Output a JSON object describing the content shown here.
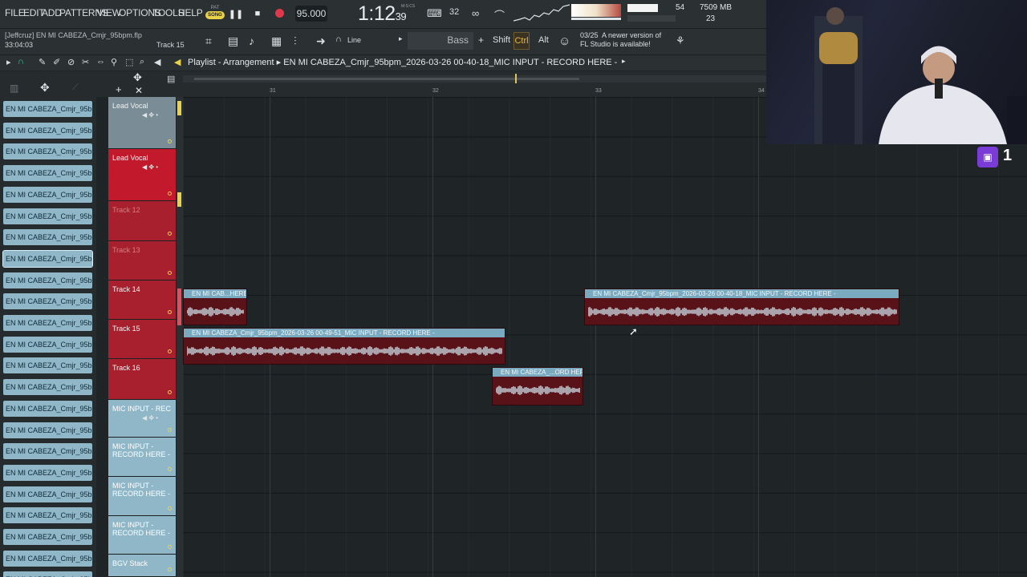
{
  "menu": [
    "FILE",
    "EDIT",
    "ADD",
    "PATTERNS",
    "VIEW",
    "OPTIONS",
    "TOOLS",
    "HELP"
  ],
  "transport": {
    "pat_label": "PAT",
    "song_label": "SONG",
    "tempo": "95.000",
    "clock_main": "1:12",
    "clock_small": "39",
    "clock_unit": "M:S:CS",
    "pattern_number": "32"
  },
  "monitor": {
    "cpu": "54",
    "memory": "7509 MB",
    "polyphony": "23"
  },
  "project": {
    "user": "[Jeffcruz]",
    "file": "EN MI CABEZA_Cmjr_95bpm.flp",
    "time": "33:04:03",
    "hint_track": "Track 15"
  },
  "toolbar": {
    "snap": "Line",
    "preset": "Bass",
    "shift": "Shift",
    "ctrl": "Ctrl",
    "alt": "Alt",
    "notice_date": "03/25",
    "notice_line1": "A newer version of",
    "notice_line2": "FL Studio is available!"
  },
  "playlist": {
    "title": "Playlist - Arrangement",
    "pattern": "EN MI CABEZA_Cmjr_95bpm_2026-03-26 00-40-18_MIC INPUT - RECORD HERE -"
  },
  "ruler": [
    "31",
    "32",
    "33",
    "34"
  ],
  "browser": {
    "items": [
      "EN MI CABEZA_Cmjr_95bp...",
      "EN MI CABEZA_Cmjr_95bp...",
      "EN MI CABEZA_Cmjr_95bp...",
      "EN MI CABEZA_Cmjr_95bp...",
      "EN MI CABEZA_Cmjr_95bp...",
      "EN MI CABEZA_Cmjr_95bp...",
      "EN MI CABEZA_Cmjr_95bp...",
      "EN MI CABEZA_Cmjr_95bp...",
      "EN MI CABEZA_Cmjr_95bp...",
      "EN MI CABEZA_Cmjr_95bp...",
      "EN MI CABEZA_Cmjr_95bp...",
      "EN MI CABEZA_Cmjr_95bp...",
      "EN MI CABEZA_Cmjr_95bp...",
      "EN MI CABEZA_Cmjr_95bp...",
      "EN MI CABEZA_Cmjr_95bp...",
      "EN MI CABEZA_Cmjr_95bp...",
      "EN MI CABEZA_Cmjr_95bp...",
      "EN MI CABEZA_Cmjr_95bp...",
      "EN MI CABEZA_Cmjr_95bp...",
      "EN MI CABEZA_Cmjr_95bp...",
      "EN MI CABEZA_Cmjr_95bp...",
      "EN MI CABEZA_Cmjr_95bp...",
      "EN MI CABEZA_Cmjr_95bp..."
    ]
  },
  "tracks": [
    {
      "name": "Lead Vocal",
      "color": "#7a8c96"
    },
    {
      "name": "Lead Vocal",
      "color": "#c21a2c"
    },
    {
      "name": "Track 12",
      "color": "#a8202e"
    },
    {
      "name": "Track 13",
      "color": "#a8202e"
    },
    {
      "name": "Track 14",
      "color": "#a8202e"
    },
    {
      "name": "Track 15",
      "color": "#a8202e"
    },
    {
      "name": "Track 16",
      "color": "#a8202e"
    },
    {
      "name": "MIC INPUT - REC",
      "color": "#8fb7c8"
    },
    {
      "name": "MIC INPUT - RECORD HERE -",
      "color": "#8fb7c8"
    },
    {
      "name": "MIC INPUT - RECORD HERE -",
      "color": "#8fb7c8"
    },
    {
      "name": "MIC INPUT - RECORD HERE -",
      "color": "#8fb7c8"
    },
    {
      "name": "BGV Stack",
      "color": "#8fb7c8"
    }
  ],
  "clips": [
    {
      "label": "EN MI CAB...HERE -"
    },
    {
      "label": "EN MI CABEZA_Cmjr_95bpm_2026-03-26 00-40-18_MIC INPUT - RECORD HERE -"
    },
    {
      "label": "EN MI CABEZA_Cmjr_95bpm_2026-03-26 00-49-51_MIC INPUT - RECORD HERE -"
    },
    {
      "label": "EN MI CABEZA_...ORD HERE -"
    }
  ],
  "overlay": {
    "viewer_count": "1"
  }
}
